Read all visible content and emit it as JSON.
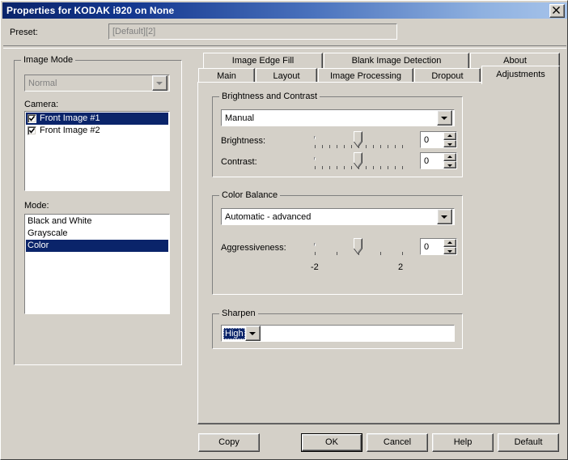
{
  "window": {
    "title": "Properties for KODAK i920 on None",
    "close_icon": "close-icon"
  },
  "preset": {
    "label": "Preset:",
    "value": "[Default][2]"
  },
  "left_panel": {
    "group_title": "Image Mode",
    "image_mode": {
      "value": "Normal",
      "disabled": true
    },
    "camera": {
      "label": "Camera:",
      "items": [
        {
          "label": "Front Image #1",
          "checked": true,
          "selected": true
        },
        {
          "label": "Front Image #2",
          "checked": true,
          "selected": false
        }
      ]
    },
    "mode": {
      "label": "Mode:",
      "items": [
        {
          "label": "Black and White",
          "selected": false
        },
        {
          "label": "Grayscale",
          "selected": false
        },
        {
          "label": "Color",
          "selected": true
        }
      ]
    }
  },
  "tabs": {
    "row1": [
      {
        "label": "Image Edge Fill",
        "active": false
      },
      {
        "label": "Blank Image Detection",
        "active": false
      },
      {
        "label": "About",
        "active": false
      }
    ],
    "row2": [
      {
        "label": "Main",
        "active": false
      },
      {
        "label": "Layout",
        "active": false
      },
      {
        "label": "Image Processing",
        "active": false
      },
      {
        "label": "Dropout",
        "active": false
      },
      {
        "label": "Adjustments",
        "active": true
      }
    ]
  },
  "adjustments": {
    "brightness_contrast": {
      "group_title": "Brightness and Contrast",
      "mode": "Manual",
      "brightness": {
        "label": "Brightness:",
        "value": "0",
        "slider_position_pct": 50,
        "tick_count": 13
      },
      "contrast": {
        "label": "Contrast:",
        "value": "0",
        "slider_position_pct": 50,
        "tick_count": 13
      }
    },
    "color_balance": {
      "group_title": "Color Balance",
      "mode": "Automatic - advanced",
      "aggressiveness": {
        "label": "Aggressiveness:",
        "value": "0",
        "slider_position_pct": 50,
        "tick_count": 5,
        "min_label": "-2",
        "max_label": "2"
      }
    },
    "sharpen": {
      "group_title": "Sharpen",
      "value": "High",
      "focused": true
    }
  },
  "buttons": [
    {
      "name": "copy-button",
      "label": "Copy",
      "default": false
    },
    {
      "name": "ok-button",
      "label": "OK",
      "default": true
    },
    {
      "name": "cancel-button",
      "label": "Cancel",
      "default": false
    },
    {
      "name": "help-button",
      "label": "Help",
      "default": false
    },
    {
      "name": "default-button",
      "label": "Default",
      "default": false
    }
  ],
  "colors": {
    "face": "#d4d0c8",
    "highlight": "#0a246a",
    "title_start": "#0a246a",
    "title_end": "#a6c3ea",
    "disabled_text": "#808080"
  }
}
